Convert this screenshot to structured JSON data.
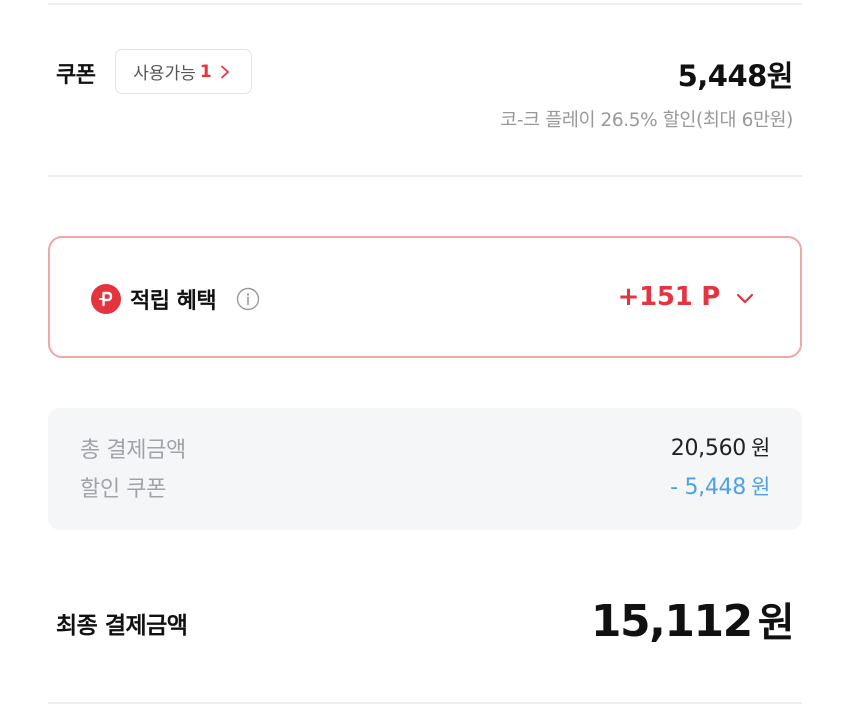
{
  "coupon": {
    "label": "쿠폰",
    "available_label": "사용가능",
    "available_count": "1",
    "amount": "5,448원",
    "description": "코-크 플레이 26.5% 할인(최대 6만원)"
  },
  "reward": {
    "label": "적립 혜택",
    "amount": "+151 P",
    "accent_color": "#e5343f",
    "border_color": "#efa7a7"
  },
  "summary": {
    "total_label": "총 결제금액",
    "total_value": "20,560",
    "total_unit": "원",
    "discount_label": "할인 쿠폰",
    "discount_value": "- 5,448",
    "discount_unit": "원",
    "discount_color": "#4fa0e6"
  },
  "final": {
    "label": "최종 결제금액",
    "value": "15,112",
    "unit": "원"
  },
  "icons": {
    "point": "point-badge-icon",
    "info": "info-icon",
    "chevron": "chevron-down-icon",
    "chip_chevron": "chevron-right-icon"
  }
}
